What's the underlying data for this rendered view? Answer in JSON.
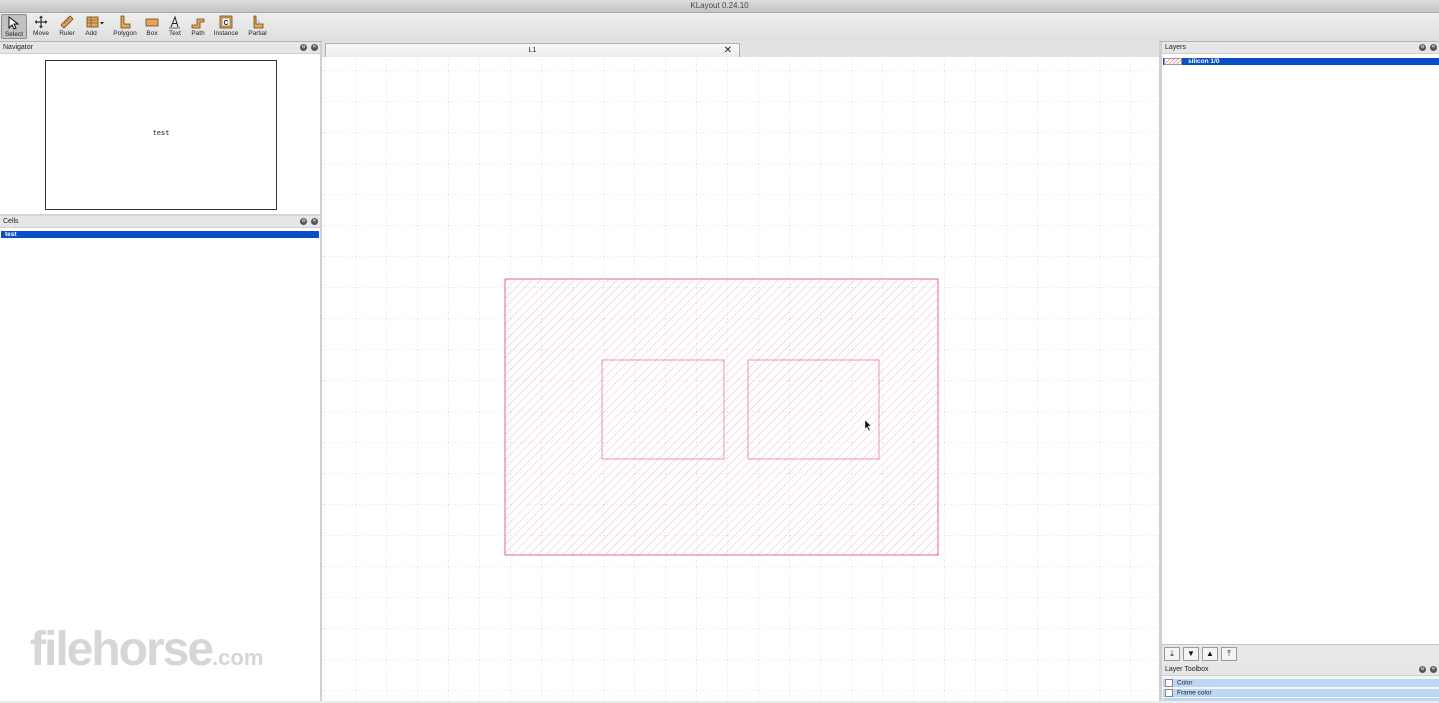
{
  "window": {
    "title": "KLayout 0.24.10"
  },
  "toolbar": {
    "tools": [
      {
        "id": "select",
        "label": "Select",
        "icon": "arrow-cursor-icon",
        "active": true
      },
      {
        "id": "move",
        "label": "Move",
        "icon": "move-cross-icon"
      },
      {
        "id": "ruler",
        "label": "Ruler",
        "icon": "ruler-icon"
      },
      {
        "id": "add",
        "label": "Add",
        "icon": "add-layout-icon"
      },
      {
        "id": "polygon",
        "label": "Polygon",
        "icon": "polygon-icon"
      },
      {
        "id": "box",
        "label": "Box",
        "icon": "box-icon"
      },
      {
        "id": "text",
        "label": "Text",
        "icon": "text-tool-icon"
      },
      {
        "id": "path",
        "label": "Path",
        "icon": "path-icon"
      },
      {
        "id": "instance",
        "label": "Instance",
        "icon": "instance-icon"
      },
      {
        "id": "partial",
        "label": "Partial",
        "icon": "partial-icon"
      }
    ]
  },
  "navigator": {
    "title": "Navigator",
    "cell_label": "test"
  },
  "cells": {
    "title": "Cells",
    "items": [
      "test"
    ]
  },
  "tabs": [
    {
      "label": "L1"
    }
  ],
  "layers": {
    "title": "Layers",
    "items": [
      {
        "name": "silicon 1/0",
        "color": "#e63c6e"
      }
    ]
  },
  "layer_toolbox": {
    "title": "Layer Toolbox",
    "items": [
      "Color",
      "Frame color"
    ]
  },
  "colors": {
    "selection": "#0a4fc6",
    "layer": "#e63c6e",
    "grid": "#b5b5b5"
  },
  "watermark": {
    "main": "filehorse",
    "suffix": ".com"
  }
}
